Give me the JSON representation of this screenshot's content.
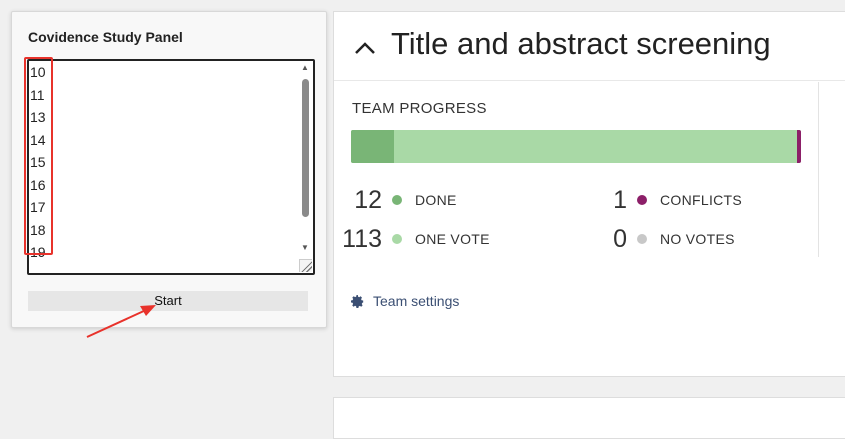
{
  "study_panel": {
    "title": "Covidence Study Panel",
    "lines": [
      "10",
      "11",
      "13",
      "14",
      "15",
      "16",
      "17",
      "18",
      "19"
    ],
    "start_label": "Start"
  },
  "screening": {
    "title": "Title and abstract screening",
    "team_progress_label": "TEAM PROGRESS",
    "progress": {
      "done": 12,
      "one_vote": 113,
      "conflicts": 1,
      "total": 126
    },
    "stats": {
      "done": {
        "value": "12",
        "label": "DONE",
        "color": "#79b576"
      },
      "one_vote": {
        "value": "113",
        "label": "ONE VOTE",
        "color": "#a9d9a6"
      },
      "conflicts": {
        "value": "1",
        "label": "CONFLICTS",
        "color": "#8c1f68"
      },
      "no_votes": {
        "value": "0",
        "label": "NO VOTES",
        "color": "#c8c8c8"
      }
    },
    "team_settings_label": "Team settings"
  },
  "icons": {
    "collapse": "chevron-up-icon",
    "settings": "gear-icon"
  },
  "annotation_color": "#e8322b"
}
